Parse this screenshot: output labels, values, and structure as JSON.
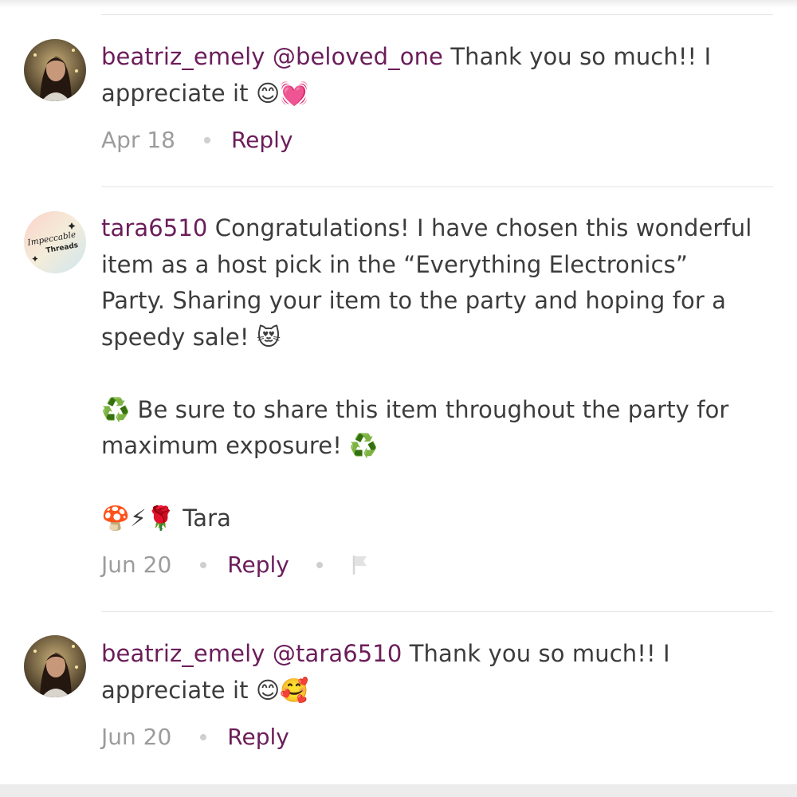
{
  "comments": [
    {
      "username": "beatriz_emely",
      "mention": "@beloved_one",
      "line1": " Thank you so much!! I",
      "line2": "appreciate it ",
      "emojis": "😊💓",
      "date": "Apr 18",
      "reply_label": "Reply"
    },
    {
      "username": "tara6510",
      "avatar_text_1": "Impeccable",
      "avatar_text_2": "Threads",
      "line1": " Congratulations! I have chosen this wonderful",
      "line2": "item as a host pick in the “Everything Electronics”",
      "line3": "Party. Sharing your item to the party and hoping for a",
      "line4": "speedy sale! ",
      "emoji4": "😻",
      "recycle_icon": "♻️",
      "para2_line1": " Be sure to share this item throughout the party for",
      "para2_line2": "maximum exposure! ",
      "signoff_emojis": "🍄⚡🌹",
      "signoff_name": " Tara",
      "date": "Jun 20",
      "reply_label": "Reply",
      "flag_icon": "flag-icon"
    },
    {
      "username": "beatriz_emely",
      "mention": "@tara6510",
      "line1": " Thank you so much!! I",
      "line2": "appreciate it ",
      "emojis": "😊🥰",
      "date": "Jun 20",
      "reply_label": "Reply"
    }
  ],
  "colors": {
    "username": "#6b1d5a",
    "text": "#3c3c3c",
    "meta": "#9c9c9c",
    "divider": "#e3e3e3"
  }
}
